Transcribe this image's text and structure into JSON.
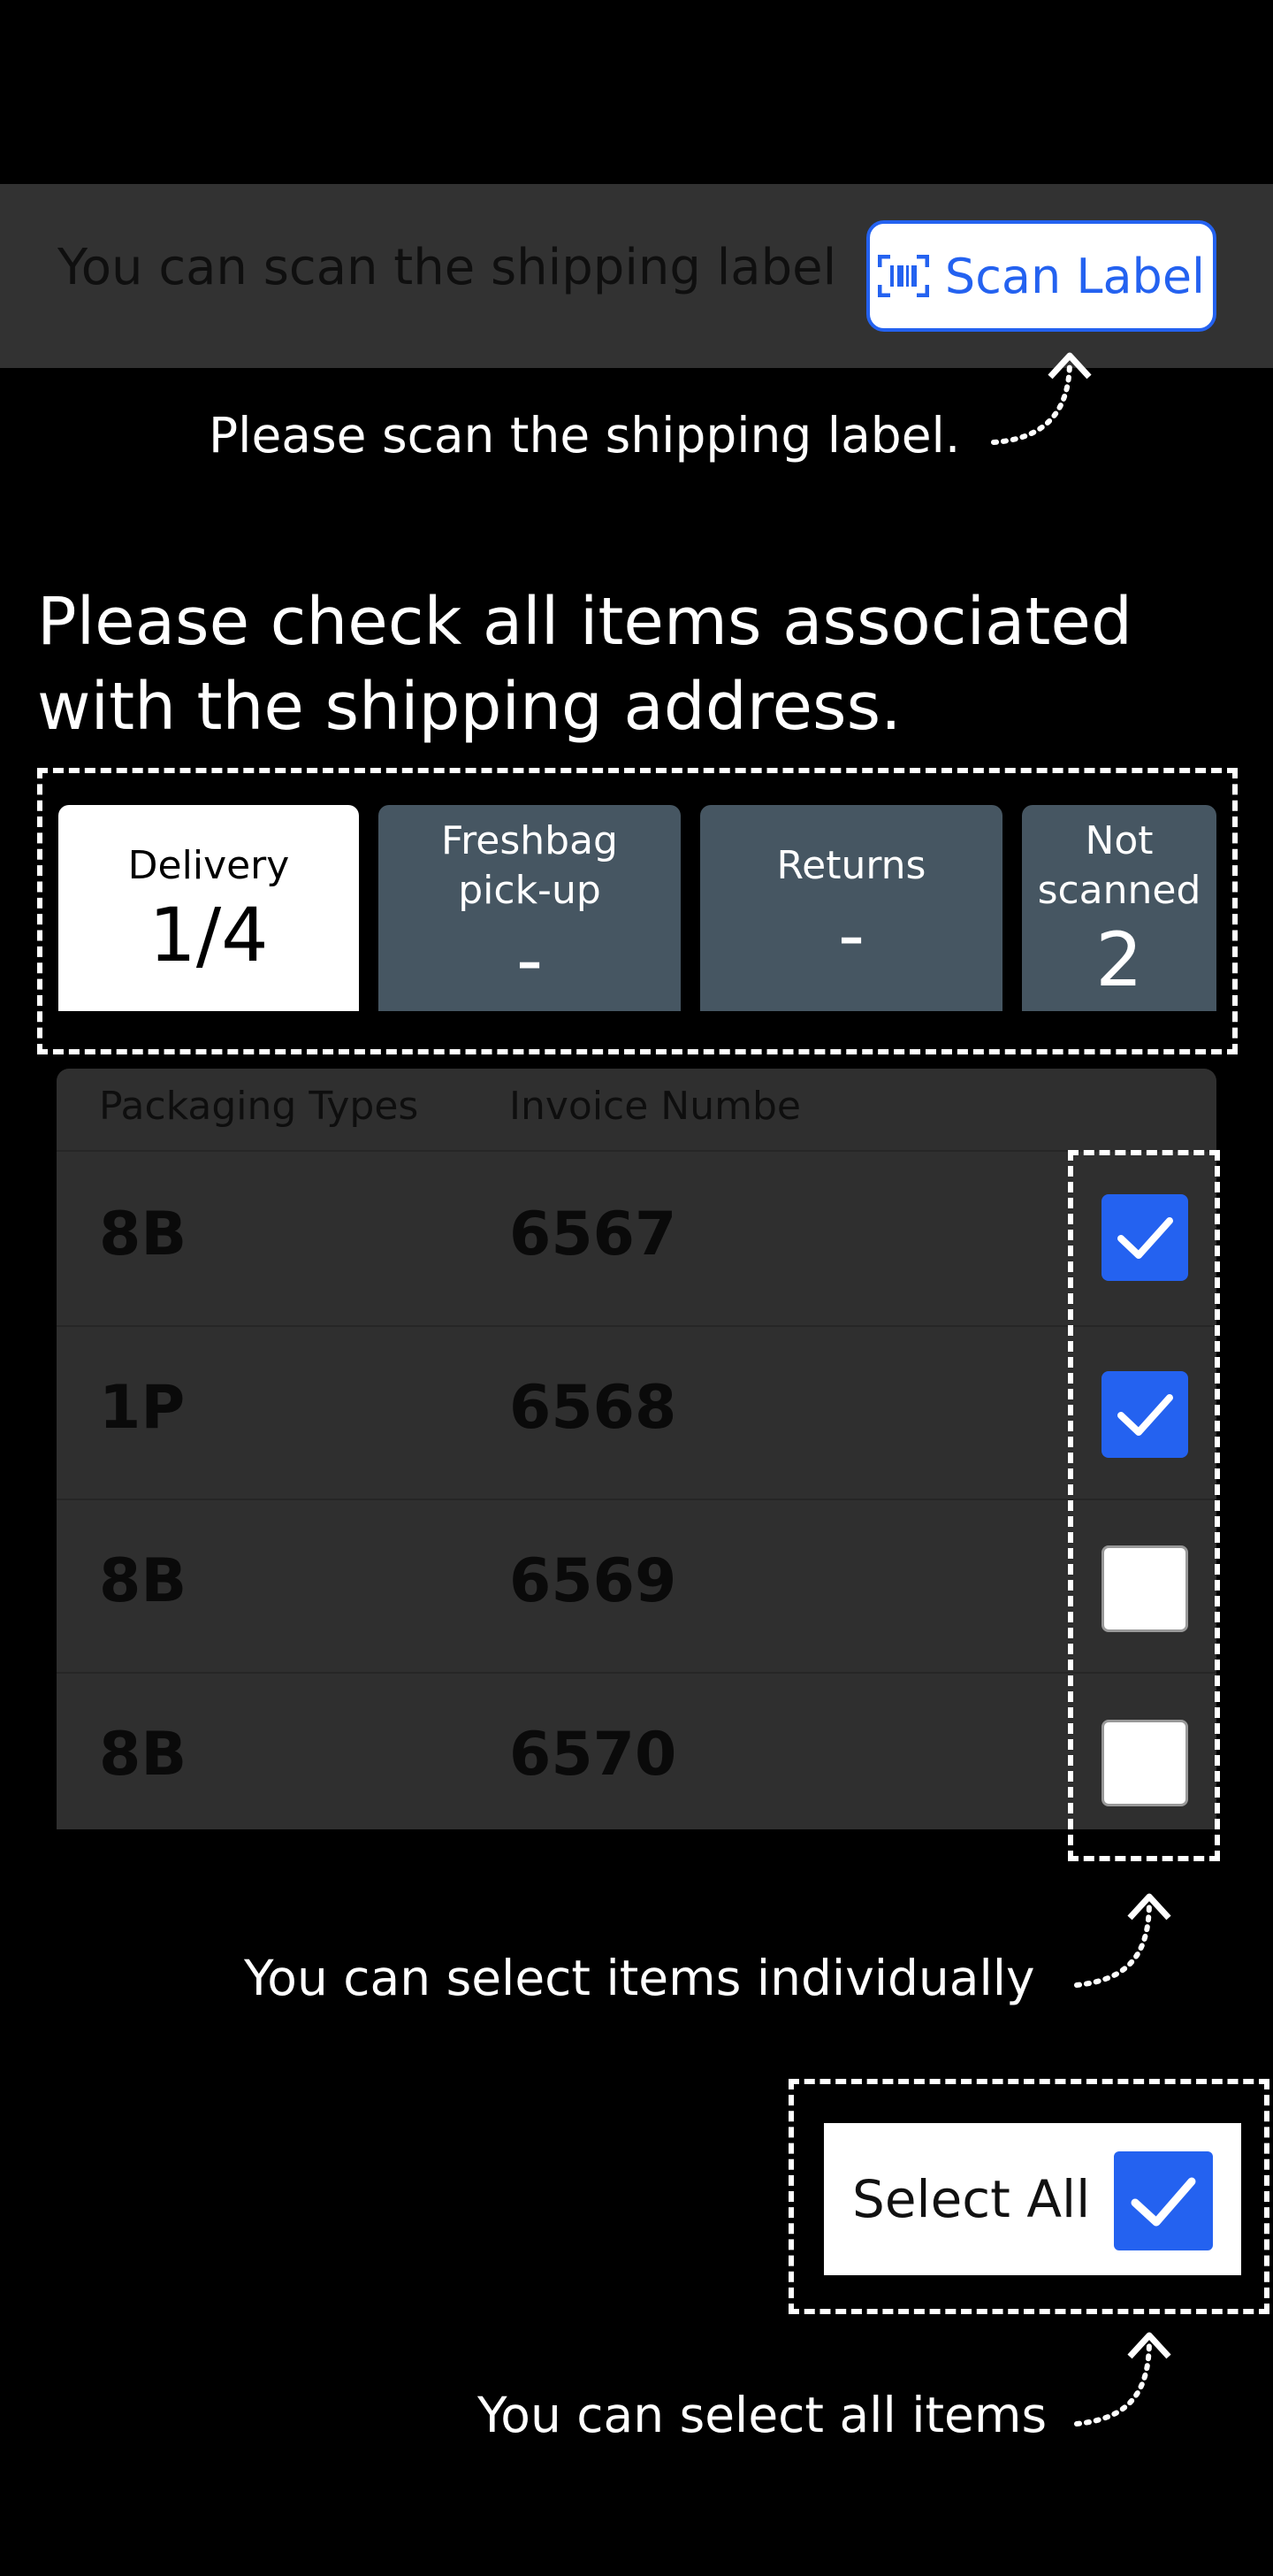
{
  "header": {
    "prompt": "You can scan the shipping label",
    "scan_button_label": "Scan Label",
    "scan_icon": "barcode-scan-icon"
  },
  "hints": {
    "scan": "Please scan the shipping label.",
    "individual": "You can select items individually",
    "all": "You can select all items"
  },
  "title": "Please check all items associated with the shipping address.",
  "tabs": [
    {
      "label": "Delivery",
      "count": "1/4",
      "active": true
    },
    {
      "label": "Freshbag pick-up",
      "count": "-",
      "active": false
    },
    {
      "label": "Returns",
      "count": "-",
      "active": false
    },
    {
      "label": "Not scanned",
      "count": "2",
      "active": false
    }
  ],
  "table": {
    "headers": [
      "Packaging Types",
      "Invoice Numbe"
    ],
    "rows": [
      {
        "type": "8B",
        "invoice": "6567",
        "checked": true
      },
      {
        "type": "1P",
        "invoice": "6568",
        "checked": true
      },
      {
        "type": "8B",
        "invoice": "6569",
        "checked": false
      },
      {
        "type": "8B",
        "invoice": "6570",
        "checked": false
      }
    ]
  },
  "select_all": {
    "label": "Select All",
    "checked": true
  },
  "colors": {
    "accent": "#2462f0",
    "tab_inactive": "#465662",
    "bar": "#323232"
  }
}
